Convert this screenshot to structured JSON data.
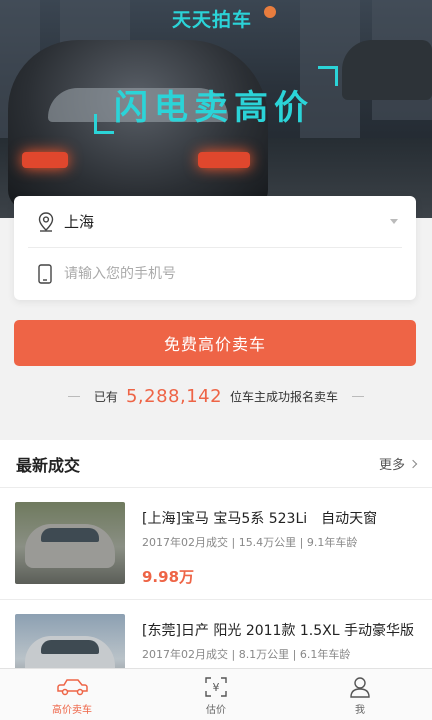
{
  "hero": {
    "brand": "天天拍车",
    "slogan": "闪电卖高价"
  },
  "form": {
    "city": "上海",
    "phone_placeholder": "请输入您的手机号"
  },
  "sell_button": "免费高价卖车",
  "stats": {
    "prefix": "已有",
    "count": "5,288,142",
    "suffix": "位车主成功报名卖车"
  },
  "deals": {
    "title": "最新成交",
    "more": "更多",
    "items": [
      {
        "name": "[上海]宝马 宝马5系 523Li　自动天窗",
        "meta": "2017年02月成交 | 15.4万公里 | 9.1年车龄",
        "price": "9.98万"
      },
      {
        "name": "[东莞]日产 阳光 2011款 1.5XL 手动豪华版",
        "meta": "2017年02月成交 | 8.1万公里 | 6.1年车龄",
        "price": ""
      }
    ]
  },
  "tabs": [
    {
      "label": "高价卖车",
      "icon": "car-icon",
      "active": true
    },
    {
      "label": "估价",
      "icon": "price-scan-icon",
      "active": false
    },
    {
      "label": "我",
      "icon": "user-icon",
      "active": false
    }
  ],
  "colors": {
    "accent": "#ee6446",
    "brand": "#2bd4d8"
  }
}
